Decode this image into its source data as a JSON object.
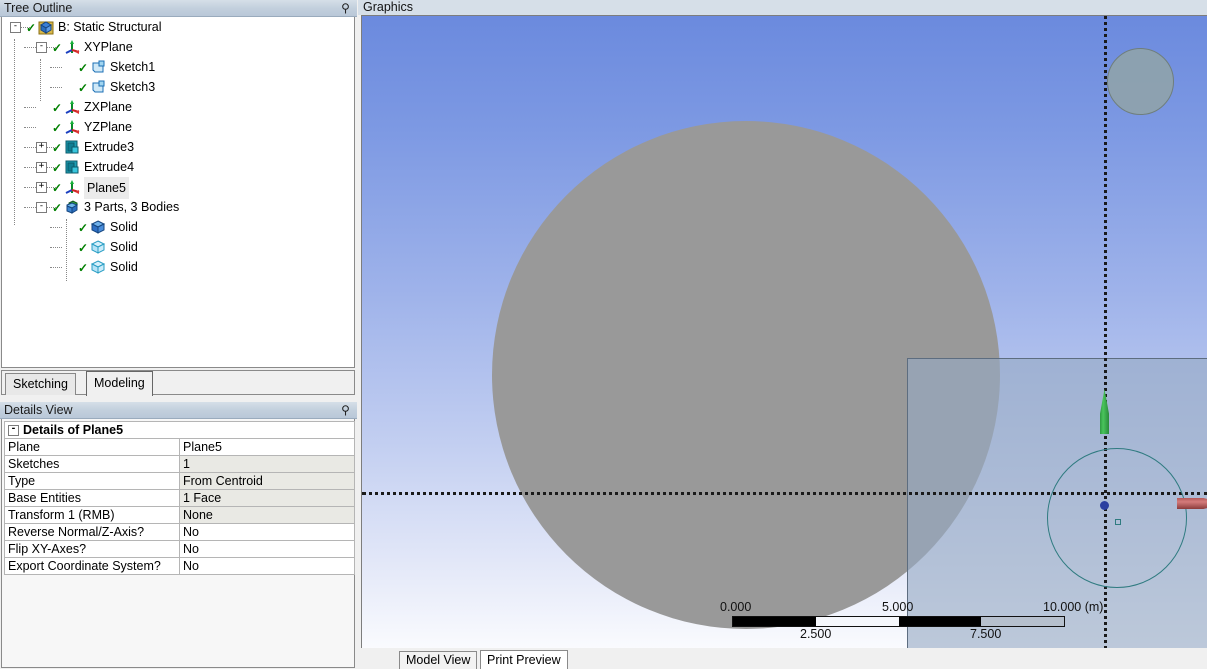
{
  "tree_panel": {
    "title": "Tree Outline",
    "pin_icon": "pin-icon",
    "nodes": [
      {
        "label": "B: Static Structural",
        "icon": "assembly-icon",
        "depth": 0,
        "toggle": "-",
        "checked": true,
        "selected": false
      },
      {
        "label": "XYPlane",
        "icon": "plane-icon",
        "depth": 1,
        "toggle": "-",
        "checked": true,
        "selected": false
      },
      {
        "label": "Sketch1",
        "icon": "sketch-icon",
        "depth": 2,
        "toggle": "",
        "checked": true,
        "selected": false
      },
      {
        "label": "Sketch3",
        "icon": "sketch-icon",
        "depth": 2,
        "toggle": "",
        "checked": true,
        "selected": false
      },
      {
        "label": "ZXPlane",
        "icon": "plane-icon",
        "depth": 1,
        "toggle": "",
        "checked": true,
        "selected": false
      },
      {
        "label": "YZPlane",
        "icon": "plane-icon",
        "depth": 1,
        "toggle": "",
        "checked": true,
        "selected": false
      },
      {
        "label": "Extrude3",
        "icon": "extrude-icon",
        "depth": 1,
        "toggle": "+",
        "checked": true,
        "selected": false
      },
      {
        "label": "Extrude4",
        "icon": "extrude-icon",
        "depth": 1,
        "toggle": "+",
        "checked": true,
        "selected": false
      },
      {
        "label": "Plane5",
        "icon": "plane-icon",
        "depth": 1,
        "toggle": "+",
        "checked": true,
        "selected": true
      },
      {
        "label": "3 Parts, 3 Bodies",
        "icon": "parts-icon",
        "depth": 1,
        "toggle": "-",
        "checked": true,
        "selected": false
      },
      {
        "label": "Solid",
        "icon": "solid-body-icon",
        "depth": 2,
        "toggle": "",
        "checked": true,
        "selected": false
      },
      {
        "label": "Solid",
        "icon": "transparent-body-icon",
        "depth": 2,
        "toggle": "",
        "checked": true,
        "selected": false
      },
      {
        "label": "Solid",
        "icon": "transparent-body-icon",
        "depth": 2,
        "toggle": "",
        "checked": true,
        "selected": false
      }
    ]
  },
  "mode_tabs": [
    {
      "label": "Sketching",
      "active": false
    },
    {
      "label": "Modeling",
      "active": true
    }
  ],
  "details_panel": {
    "title": "Details View",
    "pin_icon": "pin-icon",
    "group_toggle": "-",
    "group_label": "Details of Plane5",
    "rows": [
      {
        "key": "Plane",
        "value": "Plane5",
        "alt": false
      },
      {
        "key": "Sketches",
        "value": "1",
        "alt": true
      },
      {
        "key": "Type",
        "value": "From Centroid",
        "alt": true
      },
      {
        "key": "Base Entities",
        "value": "1 Face",
        "alt": true
      },
      {
        "key": "Transform 1 (RMB)",
        "value": "None",
        "alt": true
      },
      {
        "key": "Reverse Normal/Z-Axis?",
        "value": "No",
        "alt": false
      },
      {
        "key": "Flip XY-Axes?",
        "value": "No",
        "alt": false
      },
      {
        "key": "Export Coordinate System?",
        "value": "No",
        "alt": false
      }
    ]
  },
  "graphics": {
    "title": "Graphics",
    "background_top_color": "#6b8ade",
    "background_bottom_color": "#fafbfe",
    "body_color": "#999999",
    "plane_color": "#96aac3",
    "sketch_color": "#2f7b80",
    "origin_color": "#2b3fa0",
    "x_axis_color": "#b45a5a",
    "y_axis_color": "#49c45c",
    "ruler": {
      "unit": "(m)",
      "top_labels": [
        "0.000",
        "5.000",
        "10.000 (m)"
      ],
      "bottom_labels": [
        "2.500",
        "7.500"
      ],
      "segments": [
        "b",
        "w",
        "b",
        "g"
      ]
    },
    "view_tabs": [
      {
        "label": "Model View",
        "active": false
      },
      {
        "label": "Print Preview",
        "active": true
      }
    ]
  }
}
